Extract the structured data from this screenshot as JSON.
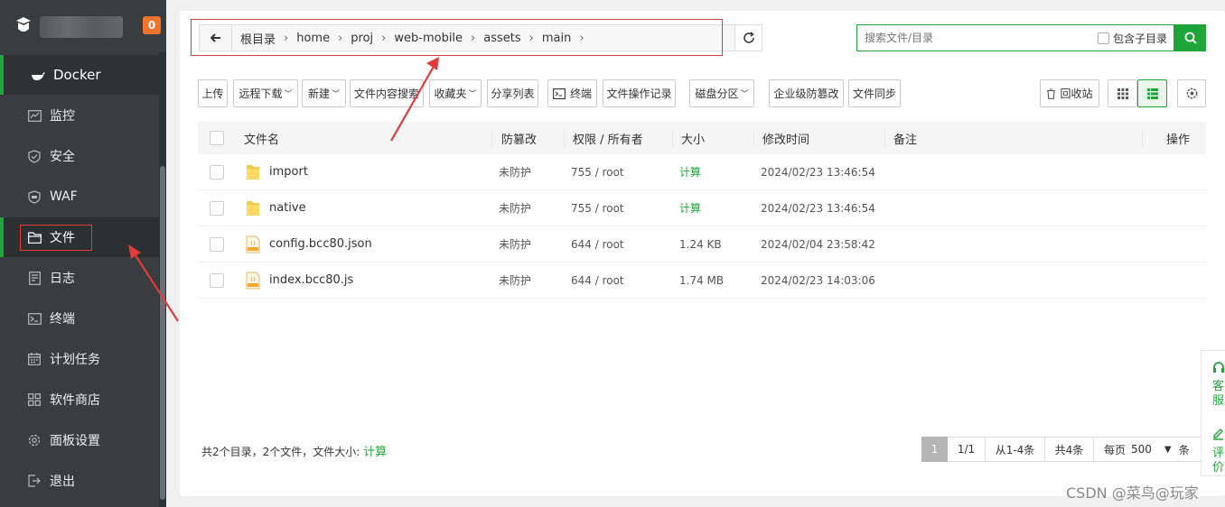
{
  "sidebar": {
    "badge": "0",
    "items": [
      {
        "label": "Docker",
        "icon": "docker-icon"
      },
      {
        "label": "监控",
        "icon": "monitor-icon"
      },
      {
        "label": "安全",
        "icon": "shield-icon"
      },
      {
        "label": "WAF",
        "icon": "waf-shield-icon"
      },
      {
        "label": "文件",
        "icon": "folder-icon"
      },
      {
        "label": "日志",
        "icon": "log-icon"
      },
      {
        "label": "终端",
        "icon": "terminal-icon"
      },
      {
        "label": "计划任务",
        "icon": "calendar-icon"
      },
      {
        "label": "软件商店",
        "icon": "apps-icon"
      },
      {
        "label": "面板设置",
        "icon": "gear-icon"
      },
      {
        "label": "退出",
        "icon": "logout-icon"
      }
    ]
  },
  "breadcrumb": [
    "根目录",
    "home",
    "proj",
    "web-mobile",
    "assets",
    "main"
  ],
  "search": {
    "placeholder": "搜索文件/目录",
    "include_sub": "包含子目录"
  },
  "toolbar": {
    "upload": "上传",
    "remote_download": "远程下载",
    "new": "新建",
    "content_search": "文件内容搜索",
    "favorites": "收藏夹",
    "share_list": "分享列表",
    "terminal": "终端",
    "op_log": "文件操作记录",
    "disk_partition": "磁盘分区",
    "enterprise_protect": "企业级防篡改",
    "file_sync": "文件同步",
    "recycle_bin": "回收站"
  },
  "table": {
    "headers": {
      "name": "文件名",
      "protect": "防篡改",
      "perm": "权限 / 所有者",
      "size": "大小",
      "mtime": "修改时间",
      "note": "备注",
      "ops": "操作"
    },
    "rows": [
      {
        "name": "import",
        "type": "folder",
        "protect": "未防护",
        "perm": "755 / root",
        "size": "计算",
        "mtime": "2024/02/23 13:46:54"
      },
      {
        "name": "native",
        "type": "folder",
        "protect": "未防护",
        "perm": "755 / root",
        "size": "计算",
        "mtime": "2024/02/23 13:46:54"
      },
      {
        "name": "config.bcc80.json",
        "type": "file",
        "protect": "未防护",
        "perm": "644 / root",
        "size": "1.24 KB",
        "mtime": "2024/02/04 23:58:42"
      },
      {
        "name": "index.bcc80.js",
        "type": "file",
        "protect": "未防护",
        "perm": "644 / root",
        "size": "1.74 MB",
        "mtime": "2024/02/23 14:03:06"
      }
    ]
  },
  "footer": {
    "summary": "共2个目录，2个文件，文件大小:",
    "calc": "计算",
    "page": "1",
    "pages": "1/1",
    "range": "从1-4条",
    "total": "共4条",
    "per_page_label": "每页",
    "per_page": "500",
    "per_page_unit": "条"
  },
  "float": {
    "service": "客服",
    "review": "评价"
  },
  "watermark": "CSDN @菜鸟@玩家",
  "colors": {
    "accent": "#20a53a",
    "sidebar": "#3a3d40",
    "badge": "#f0742d",
    "annotation": "#e03c3c"
  }
}
